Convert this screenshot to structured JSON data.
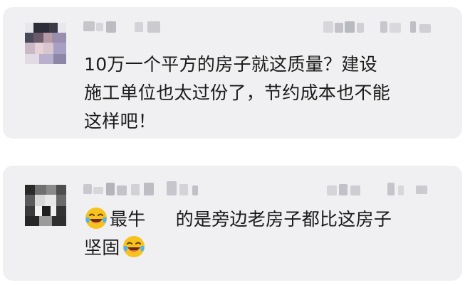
{
  "comments": [
    {
      "username_masked": "",
      "meta_masked": "",
      "lines": [
        "10万一个平方的房子就这质量？建设",
        "施工单位也太过份了，节约成本也不能",
        "这样吧！"
      ],
      "avatar_icon": "pixelated-avatar-icon"
    },
    {
      "username_masked": "",
      "meta_masked": "",
      "text_part1": "最牛",
      "text_part2": "的是旁边老房子都比这房子",
      "line2_text": "坚固",
      "emoji_icon": "laughing-crying-emoji-icon",
      "avatar_icon": "pixelated-avatar-icon"
    }
  ],
  "colors": {
    "card_bg": "#f0f0f2",
    "text": "#1a1a1a",
    "emoji_yellow": "#f7c21d"
  }
}
